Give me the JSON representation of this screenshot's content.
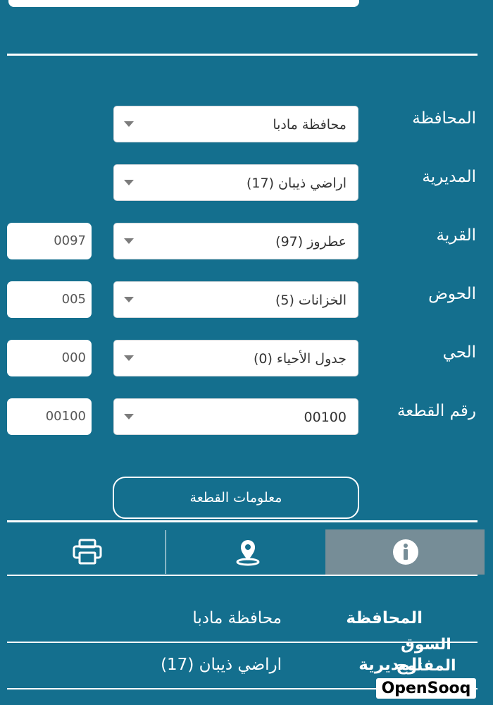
{
  "form": {
    "rows": [
      {
        "label": "المحافظة",
        "value": "محافظة مادبا",
        "code": null
      },
      {
        "label": "المديرية",
        "value": "اراضي ذيبان (17)",
        "code": null
      },
      {
        "label": "القرية",
        "value": "عطروز (97)",
        "code": "0097"
      },
      {
        "label": "الحوض",
        "value": "الخزانات (5)",
        "code": "005"
      },
      {
        "label": "الحي",
        "value": "جدول الأحياء (0)",
        "code": "000"
      },
      {
        "label": "رقم القطعة",
        "value": "00100",
        "code": "00100"
      }
    ],
    "action_label": "معلومات القطعة"
  },
  "tabs": [
    {
      "icon": "printer-icon"
    },
    {
      "icon": "location-pin-icon"
    },
    {
      "icon": "info-icon",
      "active": true
    }
  ],
  "info": {
    "rows": [
      {
        "label": "المحافظة",
        "value": "محافظة مادبا"
      },
      {
        "label": "المديرية",
        "value": "اراضي ذيبان (17)"
      }
    ]
  },
  "watermark": {
    "arabic": "السوق المفتوح",
    "english": "OpenSooq"
  },
  "colors": {
    "background": "#146f8e",
    "active_tab": "#768d97"
  }
}
